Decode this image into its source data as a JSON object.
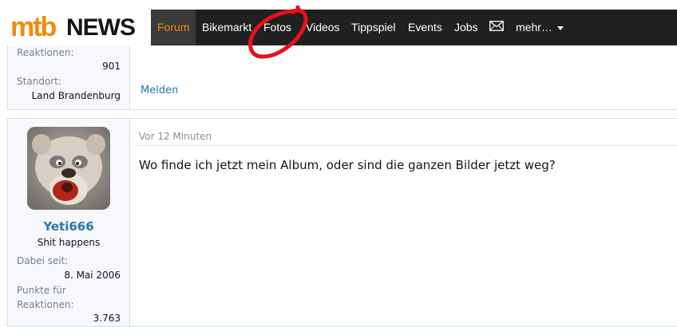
{
  "site": {
    "logo_part1": "mtb",
    "logo_part2": "NEWS",
    "brand_color": "#f08a0c",
    "nav_background": "#202020"
  },
  "nav": {
    "items": [
      "Forum",
      "Bikemarkt",
      "Fotos",
      "Videos",
      "Tippspiel",
      "Events",
      "Jobs"
    ],
    "active": "Forum",
    "mail_icon": "envelope-icon",
    "more_label": "mehr…"
  },
  "post_prev": {
    "reactions_label": "Reaktionen:",
    "reactions_value": "901",
    "location_label": "Standort:",
    "location_value": "Land Brandenburg",
    "report_label": "Melden"
  },
  "post": {
    "username": "Yeti666",
    "user_title": "Shit happens",
    "joined_label": "Dabei seit:",
    "joined_value": "8. Mai 2006",
    "points_label_1": "Punkte für",
    "points_label_2": "Reaktionen:",
    "points_value": "3.763",
    "date": "Vor 12 Minuten",
    "message": "Wo finde ich jetzt mein Album, oder sind die ganzen Bilder jetzt weg?"
  },
  "annotation": {
    "color": "#e8101a",
    "shape": "hand-drawn circle around Fotos"
  }
}
